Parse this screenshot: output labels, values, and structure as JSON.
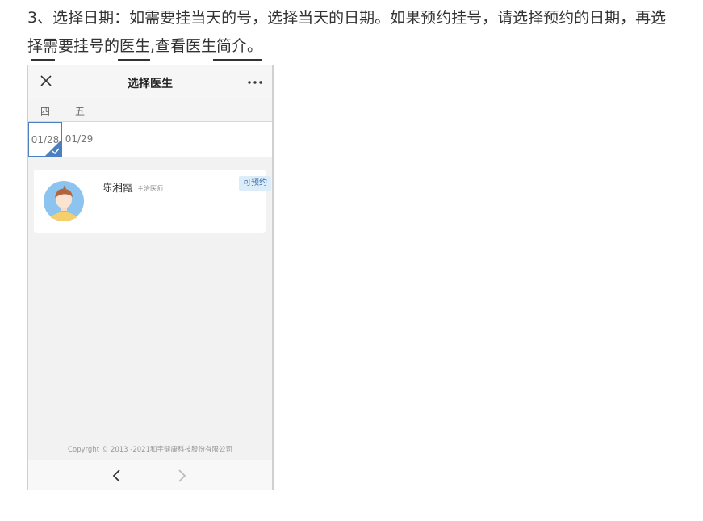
{
  "article": {
    "instruction": "3、选择日期：如需要挂当天的号，选择当天的日期。如果预约挂号，请选择预约的日期，再选择需要挂号的医生,查看医生简介。"
  },
  "page": {
    "title": "选择医生"
  },
  "week": {
    "days": [
      "四",
      "五"
    ]
  },
  "dates": [
    {
      "label": "01/28",
      "selected": true
    },
    {
      "label": "01/29",
      "selected": false
    }
  ],
  "doctor": {
    "name": "陈湘霞",
    "title": "主治医师",
    "status": "可预约"
  },
  "footer": {
    "copyright": "Copyrght © 2013 -2021和宇健康科技股份有限公司"
  },
  "icons": {
    "close": "close-icon",
    "more": "more-icon",
    "check": "check-icon",
    "back": "chevron-left-icon",
    "forward": "chevron-right-icon",
    "avatar": "doctor-avatar"
  },
  "colors": {
    "accent": "#4a7fc1",
    "badge_bg": "#dcecf8",
    "badge_text": "#3a6fa8",
    "background": "#f2f2f2"
  }
}
